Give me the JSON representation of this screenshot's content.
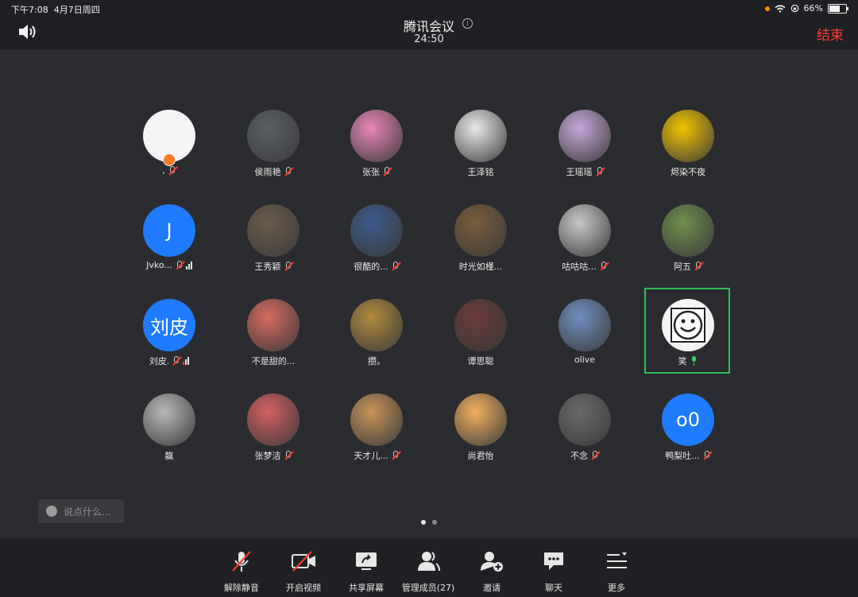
{
  "status_bar": {
    "time": "下午7:08",
    "date": "4月7日周四",
    "battery": "66%",
    "battery_level": 0.66
  },
  "header": {
    "title": "腾讯会议",
    "info_icon": "info-icon",
    "timer": "24:50",
    "end_label": "结束",
    "speaker_icon": "speaker-icon"
  },
  "participants": [
    {
      "name": ",",
      "mic": "muted"
    },
    {
      "name": "侯雨艳",
      "mic": "muted"
    },
    {
      "name": "张张",
      "mic": "muted"
    },
    {
      "name": "王泽铭",
      "mic": "none"
    },
    {
      "name": "王瑶瑶",
      "mic": "muted"
    },
    {
      "name": "烬染不夜",
      "mic": "none"
    },
    {
      "name": "Jvko...",
      "mic": "muted",
      "letter": "J"
    },
    {
      "name": "王秀颖",
      "mic": "muted"
    },
    {
      "name": "很酷的...",
      "mic": "muted"
    },
    {
      "name": "时光如槿...",
      "mic": "none"
    },
    {
      "name": "咕咕咕...",
      "mic": "muted"
    },
    {
      "name": "阿五",
      "mic": "muted"
    },
    {
      "name": "刘皮.",
      "mic": "muted",
      "letter": "刘皮"
    },
    {
      "name": "不是甜的...",
      "mic": "none"
    },
    {
      "name": "攒。",
      "mic": "none"
    },
    {
      "name": "谭思聪",
      "mic": "none"
    },
    {
      "name": "olive",
      "mic": "none"
    },
    {
      "name": "笑",
      "mic": "on"
    },
    {
      "name": "靝",
      "mic": "none"
    },
    {
      "name": "张梦洁",
      "mic": "muted"
    },
    {
      "name": "天才儿...",
      "mic": "muted"
    },
    {
      "name": "尚君怡",
      "mic": "none"
    },
    {
      "name": "不念",
      "mic": "muted"
    },
    {
      "name": "鸭梨吐...",
      "mic": "muted",
      "letter": "o0"
    }
  ],
  "chat": {
    "placeholder": "说点什么..."
  },
  "pager": {
    "pages": 2,
    "current": 1
  },
  "toolbar": [
    {
      "label": "解除静音",
      "icon": "mic-off-icon"
    },
    {
      "label": "开启视频",
      "icon": "camera-off-icon"
    },
    {
      "label": "共享屏幕",
      "icon": "share-screen-icon"
    },
    {
      "label": "管理成员(27)",
      "icon": "members-icon"
    },
    {
      "label": "邀请",
      "icon": "invite-icon"
    },
    {
      "label": "聊天",
      "icon": "chat-icon"
    },
    {
      "label": "更多",
      "icon": "more-icon"
    }
  ],
  "colors": {
    "accent_red": "#ff3b30",
    "speaking_green": "#2fbf5b",
    "avatar_blue": "#1f7bff"
  }
}
